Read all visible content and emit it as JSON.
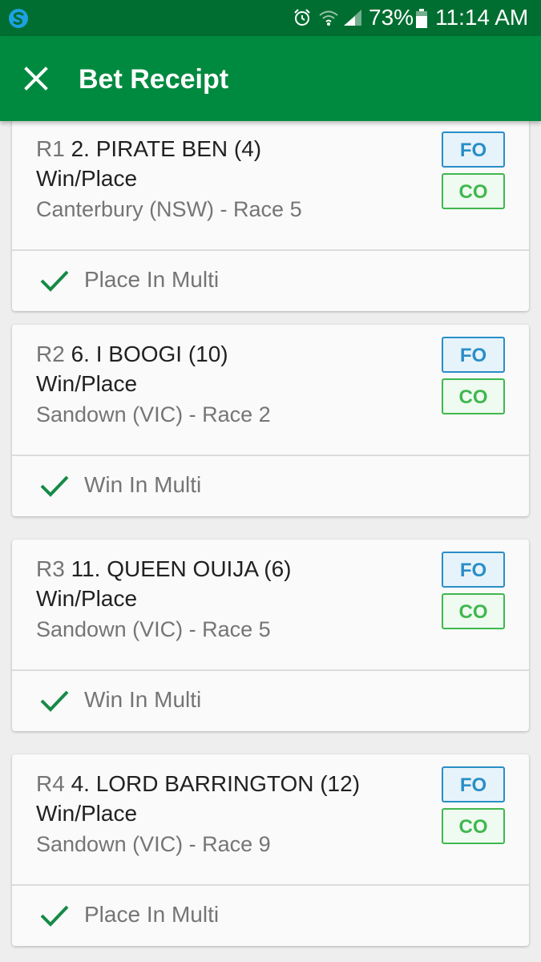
{
  "status_bar": {
    "battery": "73%",
    "time": "11:14 AM",
    "icons": [
      "app-logo-icon",
      "alarm-icon",
      "wifi-icon",
      "signal-icon",
      "battery-icon"
    ]
  },
  "app_bar": {
    "title": "Bet Receipt",
    "close_icon": "close-icon"
  },
  "colors": {
    "status_bar": "#006e31",
    "app_bar": "#008a40",
    "fo": "#2a8ec7",
    "co": "#3fb84e",
    "check": "#168a46"
  },
  "legs": [
    {
      "race_no": "R1",
      "runner": "2. PIRATE BEN (4)",
      "bet_type": "Win/Place",
      "venue": "Canterbury (NSW) - Race 5",
      "fo_label": "FO",
      "co_label": "CO",
      "result": "Place In Multi"
    },
    {
      "race_no": "R2",
      "runner": "6. I BOOGI (10)",
      "bet_type": "Win/Place",
      "venue": "Sandown (VIC) - Race 2",
      "fo_label": "FO",
      "co_label": "CO",
      "result": "Win In Multi"
    },
    {
      "race_no": "R3",
      "runner": "11. QUEEN OUIJA (6)",
      "bet_type": "Win/Place",
      "venue": "Sandown (VIC) - Race 5",
      "fo_label": "FO",
      "co_label": "CO",
      "result": "Win In Multi"
    },
    {
      "race_no": "R4",
      "runner": "4. LORD BARRINGTON (12)",
      "bet_type": "Win/Place",
      "venue": "Sandown (VIC) - Race 9",
      "fo_label": "FO",
      "co_label": "CO",
      "result": "Place In Multi"
    }
  ]
}
